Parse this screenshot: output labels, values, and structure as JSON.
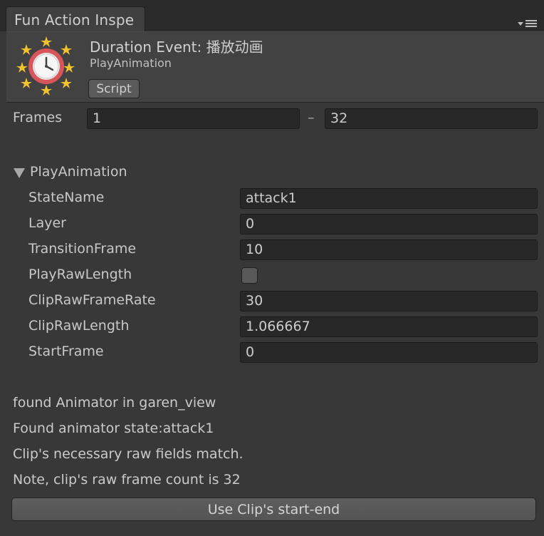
{
  "tab": {
    "title": "Fun Action Inspe"
  },
  "header": {
    "title": "Duration Event: 播放动画",
    "subtitle": "PlayAnimation",
    "script_button": "Script"
  },
  "frames": {
    "label": "Frames",
    "start": "1",
    "separator": "–",
    "end": "32"
  },
  "foldout": {
    "label": "PlayAnimation",
    "expanded": true
  },
  "properties": [
    {
      "label": "StateName",
      "value": "attack1"
    },
    {
      "label": "Layer",
      "value": "0"
    },
    {
      "label": "TransitionFrame",
      "value": "10"
    },
    {
      "label": "PlayRawLength",
      "type": "checkbox",
      "checked": false
    },
    {
      "label": "ClipRawFrameRate",
      "value": "30"
    },
    {
      "label": "ClipRawLength",
      "value": "1.066667"
    },
    {
      "label": "StartFrame",
      "value": "0"
    }
  ],
  "messages": [
    "found Animator in garen_view",
    "Found animator state:attack1",
    "Clip's necessary raw fields match.",
    "Note, clip's raw frame count is 32"
  ],
  "action_button": "Use Clip's start-end",
  "colors": {
    "background": "#383838",
    "field": "#282828",
    "header": "#424242",
    "icon_ring": "#d7565c",
    "icon_star": "#f2c230"
  },
  "icons": {
    "tab_menu": "menu-icon",
    "header": "timer-icon",
    "foldout": "triangle-down-icon"
  }
}
